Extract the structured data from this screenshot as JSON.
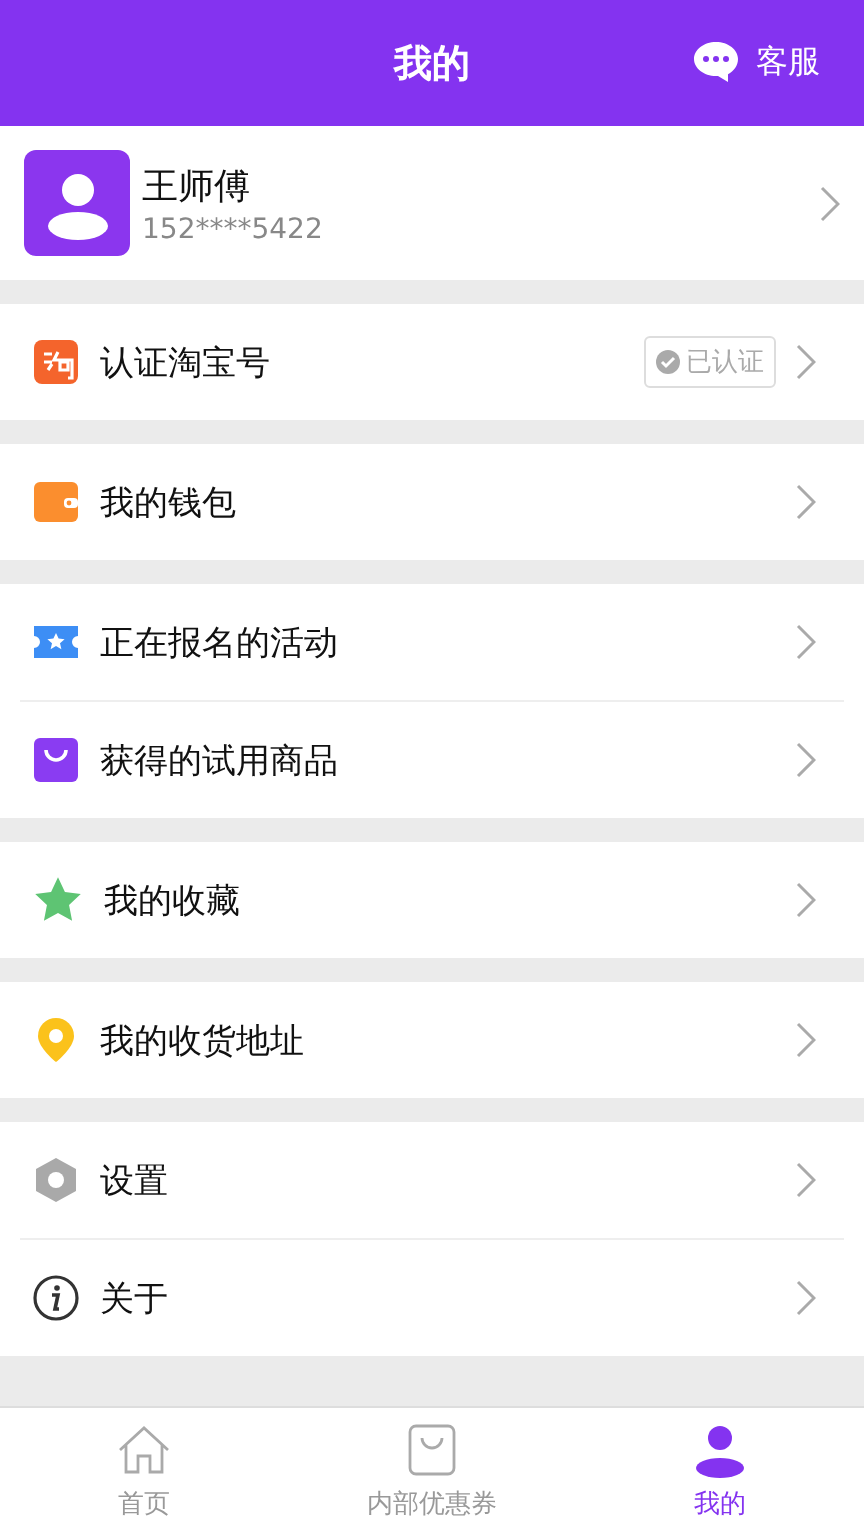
{
  "header": {
    "title": "我的",
    "service_label": "客服"
  },
  "profile": {
    "name": "王师傅",
    "phone": "152****5422"
  },
  "groups": [
    {
      "items": [
        {
          "kind": "taobao",
          "label": "认证淘宝号",
          "badge": "已认证"
        }
      ]
    },
    {
      "items": [
        {
          "kind": "wallet",
          "label": "我的钱包"
        }
      ]
    },
    {
      "items": [
        {
          "kind": "ticket",
          "label": "正在报名的活动"
        },
        {
          "kind": "bag",
          "label": "获得的试用商品"
        }
      ]
    },
    {
      "items": [
        {
          "kind": "star",
          "label": "我的收藏"
        }
      ]
    },
    {
      "items": [
        {
          "kind": "pin",
          "label": "我的收货地址"
        }
      ]
    },
    {
      "items": [
        {
          "kind": "gear",
          "label": "设置"
        },
        {
          "kind": "info",
          "label": "关于"
        }
      ]
    }
  ],
  "tabs": [
    {
      "kind": "home",
      "label": "首页",
      "selected": false
    },
    {
      "kind": "bag",
      "label": "内部优惠券",
      "selected": false
    },
    {
      "kind": "person",
      "label": "我的",
      "selected": true
    }
  ]
}
